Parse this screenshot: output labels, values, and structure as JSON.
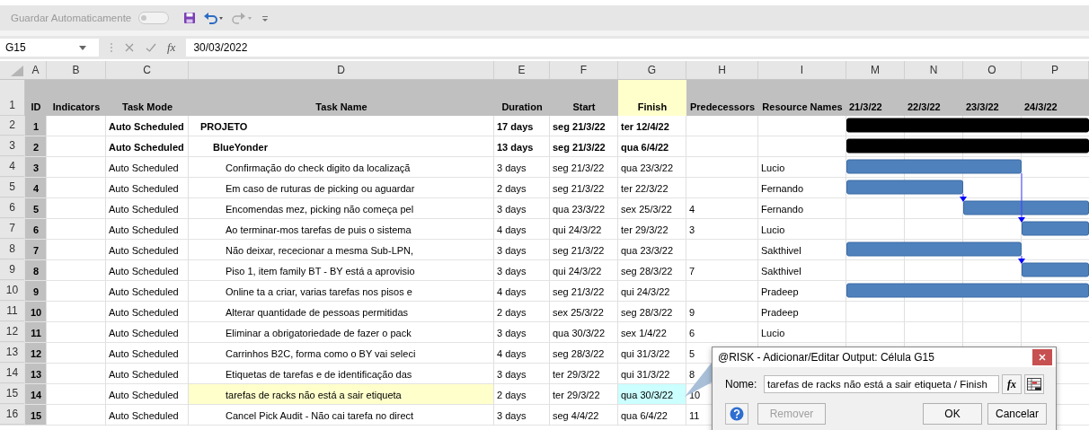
{
  "quick_access": {
    "autosave_label": "Guardar Automaticamente",
    "autosave_on": false
  },
  "formula_bar": {
    "name_box": "G15",
    "function_label": "fx",
    "value": "30/03/2022"
  },
  "header_row_number": "1",
  "columns": [
    {
      "letter": "A",
      "heading": "ID",
      "kind": "field",
      "highlighted": false
    },
    {
      "letter": "B",
      "heading": "Indicators",
      "kind": "field",
      "highlighted": false
    },
    {
      "letter": "C",
      "heading": "Task Mode",
      "kind": "field",
      "highlighted": false
    },
    {
      "letter": "D",
      "heading": "Task Name",
      "kind": "field",
      "highlighted": false
    },
    {
      "letter": "E",
      "heading": "Duration",
      "kind": "field",
      "highlighted": false
    },
    {
      "letter": "F",
      "heading": "Start",
      "kind": "field",
      "highlighted": false
    },
    {
      "letter": "G",
      "heading": "Finish",
      "kind": "field",
      "highlighted": true
    },
    {
      "letter": "H",
      "heading": "Predecessors",
      "kind": "field",
      "highlighted": false
    },
    {
      "letter": "I",
      "heading": "Resource Names",
      "kind": "field",
      "highlighted": false
    },
    {
      "letter": "M",
      "heading": "21/3/22",
      "kind": "timeline",
      "highlighted": false
    },
    {
      "letter": "N",
      "heading": "22/3/22",
      "kind": "timeline",
      "highlighted": false
    },
    {
      "letter": "O",
      "heading": "23/3/22",
      "kind": "timeline",
      "highlighted": false
    },
    {
      "letter": "P",
      "heading": "24/3/22",
      "kind": "timeline",
      "highlighted": false
    }
  ],
  "rows": [
    {
      "row_number": "2",
      "id": "1",
      "task_mode": "Auto Scheduled",
      "task_name": "PROJETO",
      "duration": "17 days",
      "start": "seg 21/3/22",
      "finish": "ter 12/4/22",
      "marked": false,
      "selected": false,
      "children": [
        {
          "row_number": "3",
          "id": "2",
          "task_mode": "Auto Scheduled",
          "task_name": "BlueYonder",
          "duration": "13 days",
          "start": "seg 21/3/22",
          "finish": "qua 6/4/22",
          "marked": false,
          "selected": false,
          "children": [
            {
              "row_number": "4",
              "id": "3",
              "task_mode": "Auto Scheduled",
              "task_name": "Confirmação do check digito da localizaçã",
              "duration": "3 days",
              "start": "seg 21/3/22",
              "finish": "qua 23/3/22",
              "resource": "Lucio",
              "marked": false,
              "selected": false
            },
            {
              "row_number": "5",
              "id": "4",
              "task_mode": "Auto Scheduled",
              "task_name": "Em caso de ruturas de picking ou aguardar",
              "duration": "2 days",
              "start": "seg 21/3/22",
              "finish": "ter 22/3/22",
              "resource": "Fernando",
              "marked": false,
              "selected": false
            },
            {
              "row_number": "6",
              "id": "5",
              "task_mode": "Auto Scheduled",
              "task_name": "Encomendas mez, picking não começa pel",
              "duration": "3 days",
              "start": "qua 23/3/22",
              "finish": "sex 25/3/22",
              "predecessors": "4",
              "resource": "Fernando",
              "marked": false,
              "selected": false
            },
            {
              "row_number": "7",
              "id": "6",
              "task_mode": "Auto Scheduled",
              "task_name": "Ao terminar-mos tarefas de puis o sistema",
              "duration": "4 days",
              "start": "qui 24/3/22",
              "finish": "ter 29/3/22",
              "predecessors": "3",
              "resource": "Lucio",
              "marked": false,
              "selected": false
            },
            {
              "row_number": "8",
              "id": "7",
              "task_mode": "Auto Scheduled",
              "task_name": "Não deixar, rececionar a mesma Sub-LPN,",
              "duration": "3 days",
              "start": "seg 21/3/22",
              "finish": "qua 23/3/22",
              "resource": "Sakthivel",
              "marked": false,
              "selected": false
            },
            {
              "row_number": "9",
              "id": "8",
              "task_mode": "Auto Scheduled",
              "task_name": "Piso 1, item family BT - BY está a aprovisio",
              "duration": "3 days",
              "start": "qui 24/3/22",
              "finish": "seg 28/3/22",
              "predecessors": "7",
              "resource": "Sakthivel",
              "marked": false,
              "selected": false
            },
            {
              "row_number": "10",
              "id": "9",
              "task_mode": "Auto Scheduled",
              "task_name": "Online ta a criar, varias tarefas nos pisos e",
              "duration": "4 days",
              "start": "seg 21/3/22",
              "finish": "qui 24/3/22",
              "resource": "Pradeep",
              "marked": false,
              "selected": false
            },
            {
              "row_number": "11",
              "id": "10",
              "task_mode": "Auto Scheduled",
              "task_name": "Alterar quantidade de pessoas permitidas",
              "duration": "2 days",
              "start": "sex 25/3/22",
              "finish": "seg 28/3/22",
              "predecessors": "9",
              "resource": "Pradeep",
              "marked": false,
              "selected": false
            },
            {
              "row_number": "12",
              "id": "11",
              "task_mode": "Auto Scheduled",
              "task_name": "Eliminar a obrigatoriedade de fazer o pack",
              "duration": "3 days",
              "start": "qua 30/3/22",
              "finish": "sex 1/4/22",
              "predecessors": "6",
              "resource": "Lucio",
              "marked": false,
              "selected": false
            },
            {
              "row_number": "13",
              "id": "12",
              "task_mode": "Auto Scheduled",
              "task_name": "Carrinhos B2C, forma como o BY vai seleci",
              "duration": "4 days",
              "start": "seg 28/3/22",
              "finish": "qui 31/3/22",
              "predecessors": "5",
              "marked": false,
              "selected": false
            },
            {
              "row_number": "14",
              "id": "13",
              "task_mode": "Auto Scheduled",
              "task_name": "Etiquetas de tarefas e de identificação das",
              "duration": "3 days",
              "start": "ter 29/3/22",
              "finish": "qui 31/3/22",
              "predecessors": "8",
              "marked": false,
              "selected": false
            },
            {
              "row_number": "15",
              "id": "14",
              "task_mode": "Auto Scheduled",
              "task_name": "tarefas de racks não está a sair etiqueta",
              "duration": "2 days",
              "start": "ter 29/3/22",
              "finish": "qua 30/3/22",
              "predecessors": "10",
              "marked": true,
              "selected": true
            },
            {
              "row_number": "16",
              "id": "15",
              "task_mode": "Auto Scheduled",
              "task_name": "Cancel Pick Audit - Não cai tarefa no direct",
              "duration": "3 days",
              "start": "seg 4/4/22",
              "finish": "qua 6/4/22",
              "predecessors": "11",
              "marked": false,
              "selected": false
            }
          ]
        }
      ]
    }
  ],
  "dialog": {
    "title": "@RISK - Adicionar/Editar Output: Célula G15",
    "name_label": "Nome:",
    "name_value": "tarefas de racks não está a sair etiqueta / Finish",
    "function_button": "fx",
    "remove_button": {
      "label": "Remover",
      "disabled": true
    },
    "ok_button": "OK",
    "cancel_button": "Cancelar"
  }
}
